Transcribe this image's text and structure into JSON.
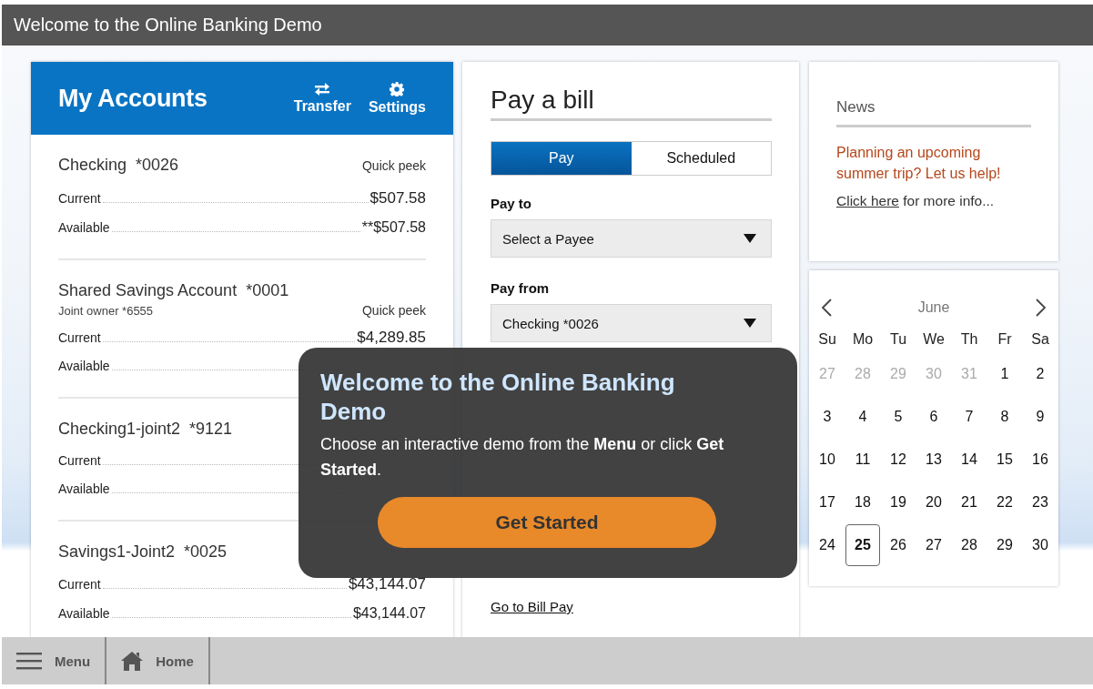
{
  "window": {
    "title": "Welcome to the Online Banking Demo"
  },
  "accounts": {
    "title": "My Accounts",
    "actions": [
      "Transfer",
      "Settings"
    ],
    "items": [
      {
        "name": "Checking",
        "number": "*0026",
        "peek": "Quick peek",
        "balances": [
          {
            "label": "Current",
            "amount": "$507.58"
          },
          {
            "label": "Available",
            "amount": "**$507.58"
          }
        ]
      },
      {
        "name": "Shared Savings Account",
        "number": "*0001",
        "owner": "Joint owner *6555",
        "peek": "Quick peek",
        "balances": [
          {
            "label": "Current",
            "amount": "$4,289.85"
          },
          {
            "label": "Available"
          }
        ]
      },
      {
        "name": "Checking1-joint2",
        "number": "*9121",
        "balances": [
          {
            "label": "Current"
          },
          {
            "label": "Available"
          }
        ]
      },
      {
        "name": "Savings1-Joint2",
        "number": "*0025",
        "balances": [
          {
            "label": "Current",
            "amount": "$43,144.07"
          },
          {
            "label": "Available",
            "amount": "$43,144.07"
          }
        ]
      }
    ]
  },
  "bill_pay": {
    "title": "Pay a bill",
    "tabs": [
      {
        "label": "Pay",
        "selected": true
      },
      {
        "label": "Scheduled",
        "selected": false
      }
    ],
    "pay_to": {
      "label": "Pay to",
      "value": "Select a Payee"
    },
    "pay_from": {
      "label": "Pay from",
      "value": "Checking *0026"
    },
    "link": "Go to Bill Pay"
  },
  "news": {
    "title": "News",
    "headline": "Planning an upcoming summer trip? Let us help!",
    "link": "Click here",
    "text": " for more info..."
  },
  "calendar": {
    "month": "June",
    "weekdays": [
      "Su",
      "Mo",
      "Tu",
      "We",
      "Th",
      "Fr",
      "Sa"
    ],
    "days": [
      {
        "label": "27",
        "muted": true,
        "selected": false
      },
      {
        "label": "28",
        "muted": true,
        "selected": false
      },
      {
        "label": "29",
        "muted": true,
        "selected": false
      },
      {
        "label": "30",
        "muted": true,
        "selected": false
      },
      {
        "label": "31",
        "muted": true,
        "selected": false
      },
      {
        "label": "1",
        "muted": false,
        "selected": false
      },
      {
        "label": "2",
        "muted": false,
        "selected": false
      },
      {
        "label": "3",
        "muted": false,
        "selected": false
      },
      {
        "label": "4",
        "muted": false,
        "selected": false
      },
      {
        "label": "5",
        "muted": false,
        "selected": false
      },
      {
        "label": "6",
        "muted": false,
        "selected": false
      },
      {
        "label": "7",
        "muted": false,
        "selected": false
      },
      {
        "label": "8",
        "muted": false,
        "selected": false
      },
      {
        "label": "9",
        "muted": false,
        "selected": false
      },
      {
        "label": "10",
        "muted": false,
        "selected": false
      },
      {
        "label": "11",
        "muted": false,
        "selected": false
      },
      {
        "label": "12",
        "muted": false,
        "selected": false
      },
      {
        "label": "13",
        "muted": false,
        "selected": false
      },
      {
        "label": "14",
        "muted": false,
        "selected": false
      },
      {
        "label": "15",
        "muted": false,
        "selected": false
      },
      {
        "label": "16",
        "muted": false,
        "selected": false
      },
      {
        "label": "17",
        "muted": false,
        "selected": false
      },
      {
        "label": "18",
        "muted": false,
        "selected": false
      },
      {
        "label": "19",
        "muted": false,
        "selected": false
      },
      {
        "label": "20",
        "muted": false,
        "selected": false
      },
      {
        "label": "21",
        "muted": false,
        "selected": false
      },
      {
        "label": "22",
        "muted": false,
        "selected": false
      },
      {
        "label": "23",
        "muted": false,
        "selected": false
      },
      {
        "label": "24",
        "muted": false,
        "selected": false
      },
      {
        "label": "25",
        "muted": false,
        "selected": true
      },
      {
        "label": "26",
        "muted": false,
        "selected": false
      },
      {
        "label": "27",
        "muted": false,
        "selected": false
      },
      {
        "label": "28",
        "muted": false,
        "selected": false
      },
      {
        "label": "29",
        "muted": false,
        "selected": false
      },
      {
        "label": "30",
        "muted": false,
        "selected": false
      }
    ]
  },
  "welcome_dialog": {
    "title": "Welcome to the Online Banking Demo",
    "message": "Choose an interactive demo from the **Menu** or click **Get Started**.",
    "button": "Get Started"
  },
  "bottom_bar": {
    "items": [
      "Menu",
      "Home"
    ]
  }
}
